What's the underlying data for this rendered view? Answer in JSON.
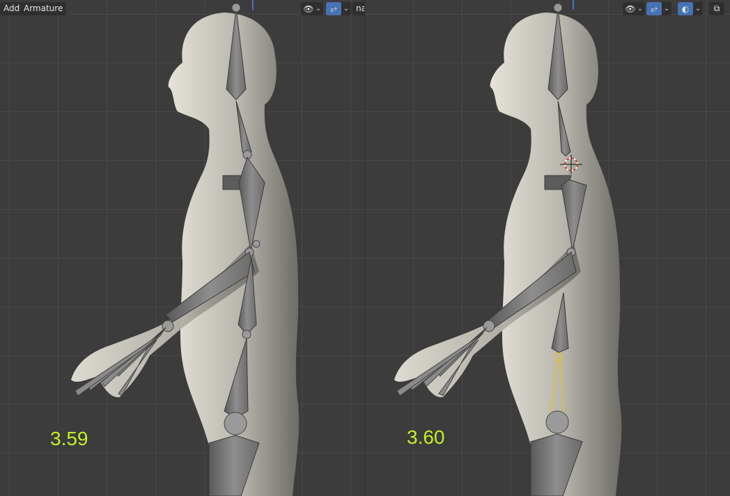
{
  "left_view": {
    "menu": {
      "add": "Add",
      "armature": "Armature",
      "object_menu_partial": "nature"
    },
    "version_label": "3.59"
  },
  "right_view": {
    "version_label": "3.60"
  },
  "icons": {
    "visibility": "eye-icon",
    "gizmo": "armature-gizmo-icon",
    "overlay": "overlay-icon",
    "xray": "xray-icon",
    "dropdown": "chevron-down-icon"
  },
  "colors": {
    "version_text": "#c4f021",
    "active_toggle": "#4772b3",
    "ik_chain": "#e8c020",
    "cursor_ring": "#d23c3c"
  }
}
